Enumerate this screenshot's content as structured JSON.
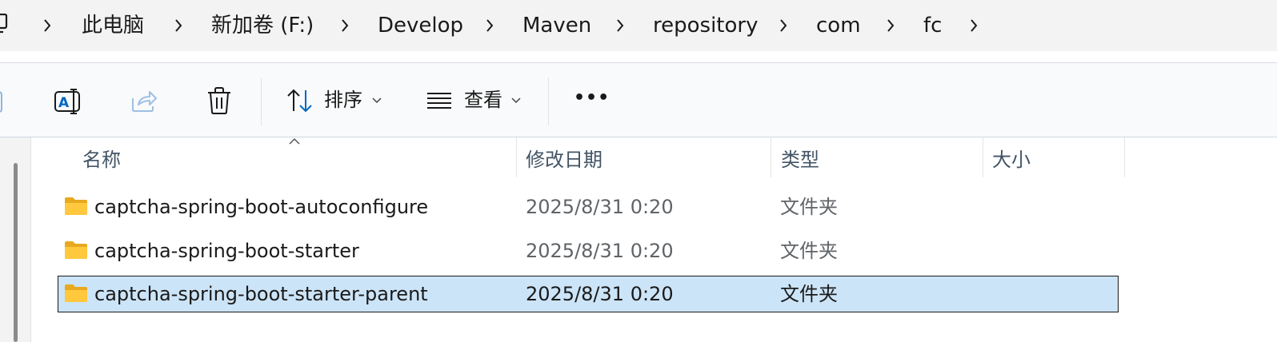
{
  "breadcrumb": {
    "items": [
      "此电脑",
      "新加卷 (F:)",
      "Develop",
      "Maven",
      "repository",
      "com",
      "fc"
    ]
  },
  "toolbar": {
    "icons": [
      "new-folder-icon",
      "rename-icon",
      "share-icon",
      "delete-icon"
    ],
    "sort_label": "排序",
    "view_label": "查看",
    "more_label": "•••"
  },
  "columns": {
    "name": "名称",
    "modified": "修改日期",
    "type": "类型",
    "size": "大小"
  },
  "files": [
    {
      "name": "captcha-spring-boot-autoconfigure",
      "modified": "2025/8/31 0:20",
      "type": "文件夹",
      "size": "",
      "selected": false
    },
    {
      "name": "captcha-spring-boot-starter",
      "modified": "2025/8/31 0:20",
      "type": "文件夹",
      "size": "",
      "selected": false
    },
    {
      "name": "captcha-spring-boot-starter-parent",
      "modified": "2025/8/31 0:20",
      "type": "文件夹",
      "size": "",
      "selected": true
    }
  ],
  "colors": {
    "selection_bg": "#cce4f7",
    "folder_yellow": "#ffc83d",
    "accent": "#0067c0"
  }
}
